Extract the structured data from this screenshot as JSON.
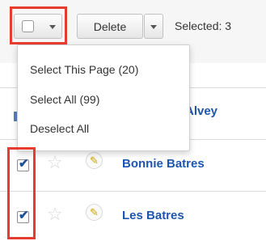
{
  "toolbar": {
    "checkbox_dropdown": {
      "icons": [
        "checkbox-icon",
        "chevron-down-icon"
      ]
    },
    "delete_label": "Delete",
    "selected_text": "Selected: 3"
  },
  "dropdown_menu": {
    "items": [
      {
        "label": "Select This Page (20)"
      },
      {
        "label": "Select All (99)"
      },
      {
        "label": "Deselect All"
      }
    ]
  },
  "list": {
    "rows": [
      {
        "name": "Alvey",
        "checked": false
      },
      {
        "name": "Bonnie Batres",
        "checked": true
      },
      {
        "name": "Les Batres",
        "checked": true
      }
    ]
  },
  "colors": {
    "highlight_box": "#e73b2f",
    "link": "#1d55b0"
  }
}
